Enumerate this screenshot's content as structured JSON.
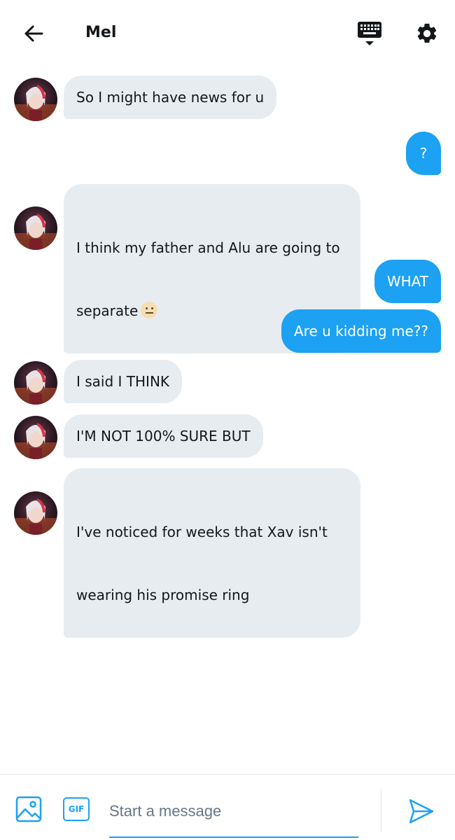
{
  "header": {
    "title": "Mel"
  },
  "messages": [
    {
      "side": "in",
      "text": "So I might have news for u"
    },
    {
      "side": "out",
      "text": "?"
    },
    {
      "side": "in",
      "line1": "I think my father and Alu are going to",
      "line2": "separate",
      "emoji": "neutral-face-emoji"
    },
    {
      "side": "out",
      "text": "WHAT"
    },
    {
      "side": "out",
      "text": "Are u kidding me??"
    },
    {
      "side": "in",
      "text": "I said I THINK"
    },
    {
      "side": "in",
      "text": "I'M NOT 100% SURE BUT"
    },
    {
      "side": "in",
      "line1": "I've noticed for weeks that Xav isn't",
      "line2": "wearing his promise ring"
    }
  ],
  "composer": {
    "placeholder": "Start a message",
    "gif_label": "GIF"
  },
  "colors": {
    "accent": "#1da1f2",
    "incoming_bubble": "#e6ecf0",
    "text": "#14171a",
    "placeholder": "#657786"
  },
  "icons": [
    "back-arrow-icon",
    "keyboard-icon",
    "gear-icon",
    "image-icon",
    "gif-icon",
    "send-icon",
    "avatar"
  ]
}
